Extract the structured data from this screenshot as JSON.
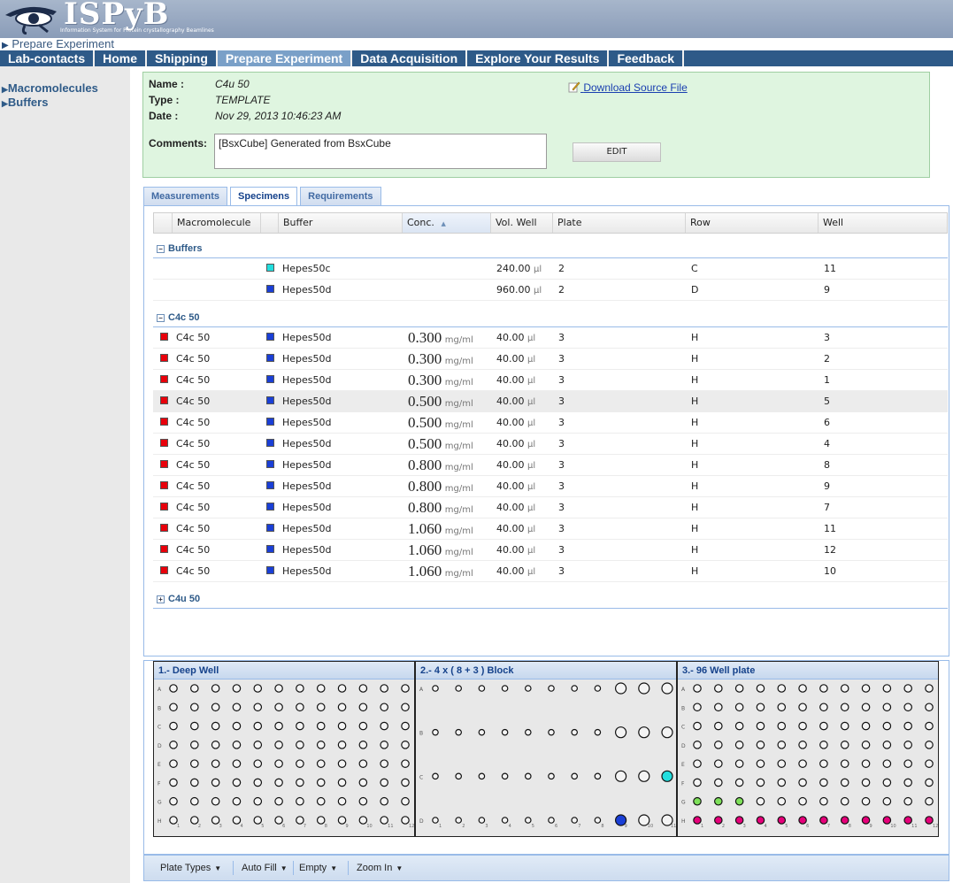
{
  "header": {
    "logo": "ISPyB",
    "logo_subtitle": "Information System for Protein crystallography Beamlines"
  },
  "breadcrumb": "Prepare Experiment",
  "nav": [
    "Lab-contacts",
    "Home",
    "Shipping",
    "Prepare Experiment",
    "Data Acquisition",
    "Explore Your Results",
    "Feedback"
  ],
  "nav_active": "Prepare Experiment",
  "sidebar": {
    "items": [
      {
        "label": "Macromolecules"
      },
      {
        "label": "Buffers"
      }
    ]
  },
  "info": {
    "name_label": "Name :",
    "name": "C4u 50",
    "type_label": "Type :",
    "type": "TEMPLATE",
    "date_label": "Date :",
    "date": "Nov 29, 2013 10:46:23 AM",
    "comments_label": "Comments:",
    "comments": "[BsxCube] Generated from BsxCube",
    "download_link": "Download Source File",
    "edit_button": "EDIT"
  },
  "tabs": [
    "Measurements",
    "Specimens",
    "Requirements"
  ],
  "active_tab": "Specimens",
  "grid": {
    "columns": [
      "Macromolecule",
      "Buffer",
      "Conc.",
      "Vol. Well",
      "Plate",
      "Row",
      "Well"
    ],
    "colors": {
      "red": "#e8000b",
      "blue": "#1a3fd6",
      "cyan": "#22dddd"
    },
    "groups": [
      {
        "name": "Buffers",
        "expanded": "⊟",
        "rows": [
          {
            "macro": "",
            "buffer": "Hepes50c",
            "buffer_color": "#22dddd",
            "conc": "",
            "vol": "240.00",
            "plate": "2",
            "row": "C",
            "well": "11"
          },
          {
            "macro": "",
            "buffer": "Hepes50d",
            "buffer_color": "#1a3fd6",
            "conc": "",
            "vol": "960.00",
            "plate": "2",
            "row": "D",
            "well": "9"
          }
        ]
      },
      {
        "name": "C4c 50",
        "expanded": "⊟",
        "rows": [
          {
            "macro": "C4c 50",
            "buffer": "Hepes50d",
            "buffer_color": "#1a3fd6",
            "conc": "0.300",
            "vol": "40.00",
            "plate": "3",
            "row": "H",
            "well": "3"
          },
          {
            "macro": "C4c 50",
            "buffer": "Hepes50d",
            "buffer_color": "#1a3fd6",
            "conc": "0.300",
            "vol": "40.00",
            "plate": "3",
            "row": "H",
            "well": "2"
          },
          {
            "macro": "C4c 50",
            "buffer": "Hepes50d",
            "buffer_color": "#1a3fd6",
            "conc": "0.300",
            "vol": "40.00",
            "plate": "3",
            "row": "H",
            "well": "1"
          },
          {
            "macro": "C4c 50",
            "buffer": "Hepes50d",
            "buffer_color": "#1a3fd6",
            "conc": "0.500",
            "vol": "40.00",
            "plate": "3",
            "row": "H",
            "well": "5"
          },
          {
            "macro": "C4c 50",
            "buffer": "Hepes50d",
            "buffer_color": "#1a3fd6",
            "conc": "0.500",
            "vol": "40.00",
            "plate": "3",
            "row": "H",
            "well": "6"
          },
          {
            "macro": "C4c 50",
            "buffer": "Hepes50d",
            "buffer_color": "#1a3fd6",
            "conc": "0.500",
            "vol": "40.00",
            "plate": "3",
            "row": "H",
            "well": "4"
          },
          {
            "macro": "C4c 50",
            "buffer": "Hepes50d",
            "buffer_color": "#1a3fd6",
            "conc": "0.800",
            "vol": "40.00",
            "plate": "3",
            "row": "H",
            "well": "8"
          },
          {
            "macro": "C4c 50",
            "buffer": "Hepes50d",
            "buffer_color": "#1a3fd6",
            "conc": "0.800",
            "vol": "40.00",
            "plate": "3",
            "row": "H",
            "well": "9"
          },
          {
            "macro": "C4c 50",
            "buffer": "Hepes50d",
            "buffer_color": "#1a3fd6",
            "conc": "0.800",
            "vol": "40.00",
            "plate": "3",
            "row": "H",
            "well": "7"
          },
          {
            "macro": "C4c 50",
            "buffer": "Hepes50d",
            "buffer_color": "#1a3fd6",
            "conc": "1.060",
            "vol": "40.00",
            "plate": "3",
            "row": "H",
            "well": "11"
          },
          {
            "macro": "C4c 50",
            "buffer": "Hepes50d",
            "buffer_color": "#1a3fd6",
            "conc": "1.060",
            "vol": "40.00",
            "plate": "3",
            "row": "H",
            "well": "12"
          },
          {
            "macro": "C4c 50",
            "buffer": "Hepes50d",
            "buffer_color": "#1a3fd6",
            "conc": "1.060",
            "vol": "40.00",
            "plate": "3",
            "row": "H",
            "well": "10"
          }
        ]
      },
      {
        "name": "C4u 50",
        "expanded": "⊞",
        "rows": []
      }
    ],
    "conc_unit": "mg/ml",
    "vol_unit": "µl"
  },
  "plates": [
    {
      "title": "1.- Deep Well",
      "rows": [
        "A",
        "B",
        "C",
        "D",
        "E",
        "F",
        "G",
        "H"
      ],
      "cols": [
        "1",
        "2",
        "3",
        "4",
        "5",
        "6",
        "7",
        "8",
        "9",
        "10",
        "11",
        "12"
      ],
      "filled": {}
    },
    {
      "title": "2.- 4 x ( 8 + 3 ) Block",
      "rows": [
        "A",
        "B",
        "C",
        "D"
      ],
      "cols": [
        "1",
        "2",
        "3",
        "4",
        "5",
        "6",
        "7",
        "8",
        "9",
        "10",
        "11"
      ],
      "filled": {
        "C11": "#22dddd",
        "D9": "#1a3fd6"
      }
    },
    {
      "title": "3.- 96 Well plate",
      "rows": [
        "A",
        "B",
        "C",
        "D",
        "E",
        "F",
        "G",
        "H"
      ],
      "cols": [
        "1",
        "2",
        "3",
        "4",
        "5",
        "6",
        "7",
        "8",
        "9",
        "10",
        "11",
        "12"
      ],
      "filled": {
        "G1": "#7ee05a",
        "G2": "#7ee05a",
        "G3": "#7ee05a",
        "H1": "#e6007a",
        "H2": "#e6007a",
        "H3": "#e6007a",
        "H4": "#e6007a",
        "H5": "#e6007a",
        "H6": "#e6007a",
        "H7": "#e6007a",
        "H8": "#e6007a",
        "H9": "#e6007a",
        "H10": "#e6007a",
        "H11": "#e6007a",
        "H12": "#e6007a"
      }
    }
  ],
  "toolbar": [
    "Plate Types",
    "Auto Fill",
    "Empty",
    "Zoom In"
  ]
}
